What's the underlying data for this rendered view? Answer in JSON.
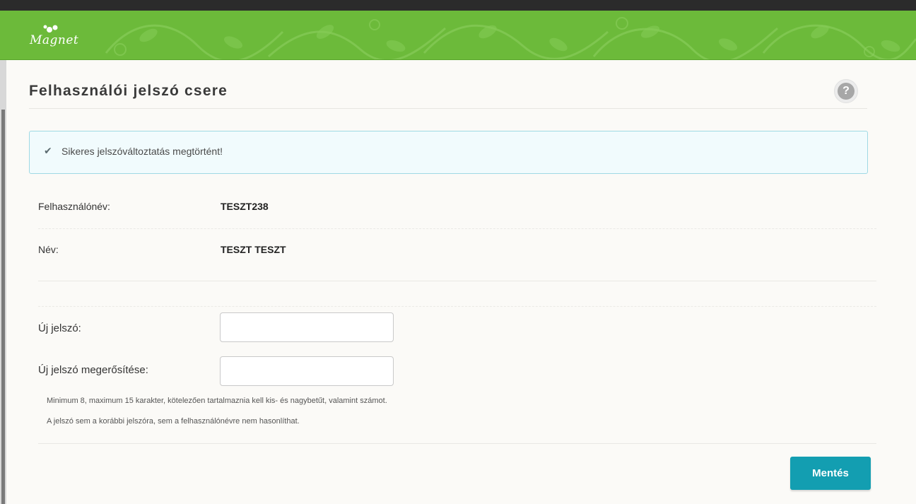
{
  "header": {
    "logo_text": "Magnet",
    "accent": "#6cba3a"
  },
  "page": {
    "title": "Felhasználói jelszó csere",
    "help_icon": "?"
  },
  "alert": {
    "icon": "check-icon",
    "glyph": "✔",
    "message": "Sikeres jelszóváltoztatás megtörtént!"
  },
  "user": {
    "username_label": "Felhasználónév:",
    "username_value": "TESZT238",
    "name_label": "Név:",
    "name_value": "TESZT TESZT"
  },
  "form": {
    "new_password_label": "Új jelszó:",
    "new_password_value": "",
    "confirm_password_label": "Új jelszó megerősítése:",
    "confirm_password_value": "",
    "hint1": "Minimum 8, maximum 15 karakter, kötelezően tartalmaznia kell kis- és nagybetűt, valamint számot.",
    "hint2": "A jelszó sem a korábbi jelszóra, sem a felhasználónévre nem hasonlíthat.",
    "save_label": "Mentés",
    "save_color": "#139eb1"
  }
}
